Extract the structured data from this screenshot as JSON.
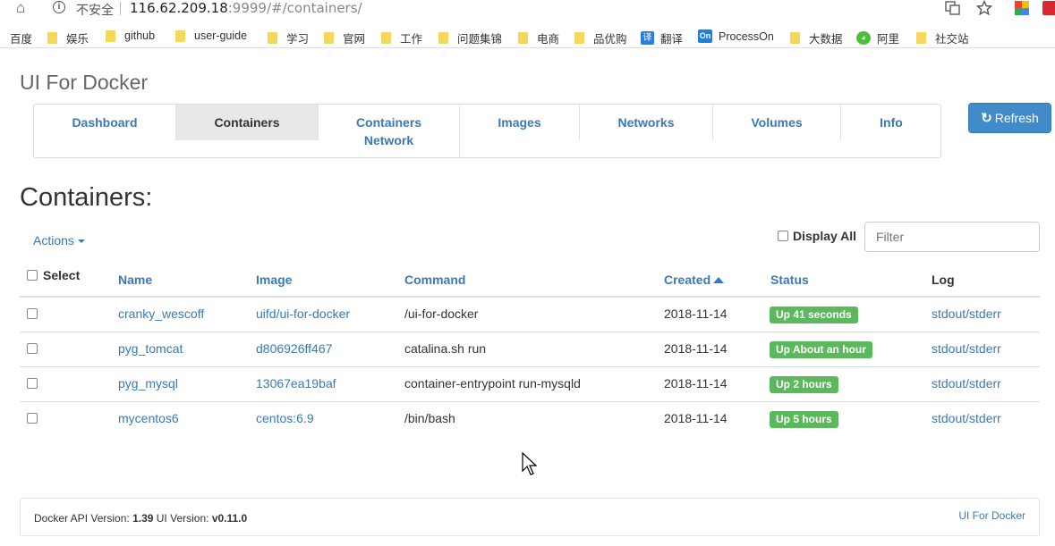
{
  "browser": {
    "security_label": "不安全",
    "url_host": "116.62.209.18",
    "url_rest": ":9999/#/containers/",
    "bookmarks": [
      "百度",
      "娱乐",
      "github",
      "user-guide",
      "学习",
      "官网",
      "工作",
      "问题集锦",
      "电商",
      "品优购",
      "翻译",
      "ProcessOn",
      "大数据",
      "阿里",
      "社交站"
    ],
    "translate_badge": "译",
    "processon_badge": "On"
  },
  "app": {
    "title": "UI For Docker",
    "nav": [
      "Dashboard",
      "Containers",
      "Containers Network",
      "Images",
      "Networks",
      "Volumes",
      "Info"
    ],
    "refresh_label": "Refresh"
  },
  "page": {
    "title": "Containers:",
    "actions_label": "Actions",
    "display_all_label": "Display All",
    "filter_placeholder": "Filter"
  },
  "table": {
    "headers": [
      "Select",
      "Name",
      "Image",
      "Command",
      "Created",
      "Status",
      "Log"
    ],
    "rows": [
      {
        "name": "cranky_wescoff",
        "image": "uifd/ui-for-docker",
        "command": "/ui-for-docker",
        "created": "2018-11-14",
        "status": "Up 41 seconds",
        "log": "stdout/stderr"
      },
      {
        "name": "pyg_tomcat",
        "image": "d806926ff467",
        "command": "catalina.sh run",
        "created": "2018-11-14",
        "status": "Up About an hour",
        "log": "stdout/stderr"
      },
      {
        "name": "pyg_mysql",
        "image": "13067ea19baf",
        "command": "container-entrypoint run-mysqld",
        "created": "2018-11-14",
        "status": "Up 2 hours",
        "log": "stdout/stderr"
      },
      {
        "name": "mycentos6",
        "image": "centos:6.9",
        "command": "/bin/bash",
        "created": "2018-11-14",
        "status": "Up 5 hours",
        "log": "stdout/stderr"
      }
    ]
  },
  "footer": {
    "api_label": "Docker API Version:",
    "api_version": "1.39",
    "ui_label": "UI Version:",
    "ui_version": "v0.11.0",
    "link": "UI For Docker"
  },
  "colors": {
    "link": "#3a79b8",
    "primary": "#428bca",
    "success": "#5cb85c"
  }
}
